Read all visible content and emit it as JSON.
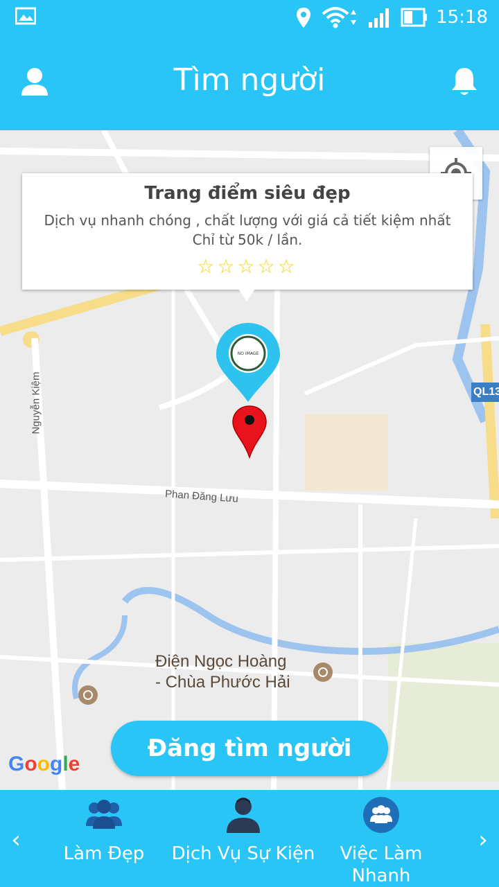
{
  "status_bar": {
    "time": "15:18",
    "icons": [
      "image-icon",
      "location-icon",
      "wifi-icon",
      "signal-icon",
      "battery-icon"
    ]
  },
  "header": {
    "title": "Tìm người",
    "left_icon": "user-icon",
    "right_icon": "bell-icon"
  },
  "map": {
    "road_labels": [
      "Nguyễn Kiệm",
      "Phan Đăng Lưu",
      "QL13"
    ],
    "poi_label_line1": "Điện Ngọc Hoàng",
    "poi_label_line2": "- Chùa Phước Hải",
    "locate_icon": "crosshair-icon",
    "attribution": "Google"
  },
  "info_card": {
    "title": "Trang điểm siêu đẹp",
    "description_line1": "Dịch vụ nhanh chóng , chất lượng với giá cả tiết kiệm nhất",
    "description_line2": "Chỉ từ 50k / lần.",
    "stars": "☆☆☆☆☆",
    "rating": 0,
    "pin_image_text": "NO IMAGE AVAILABLE"
  },
  "post_button": {
    "label": "Đăng tìm người"
  },
  "bottom_nav": {
    "prev_arrow": "‹",
    "next_arrow": "›",
    "items": [
      {
        "label": "Làm Đẹp",
        "icon": "group-icon"
      },
      {
        "label": "Dịch Vụ Sự Kiện",
        "icon": "person-icon"
      },
      {
        "label": "Việc Làm Nhanh",
        "icon": "team-circle-icon"
      }
    ]
  },
  "colors": {
    "primary": "#29c5f6",
    "map_bg": "#ececec",
    "star": "#f5d312",
    "red_pin": "#e8131b"
  }
}
